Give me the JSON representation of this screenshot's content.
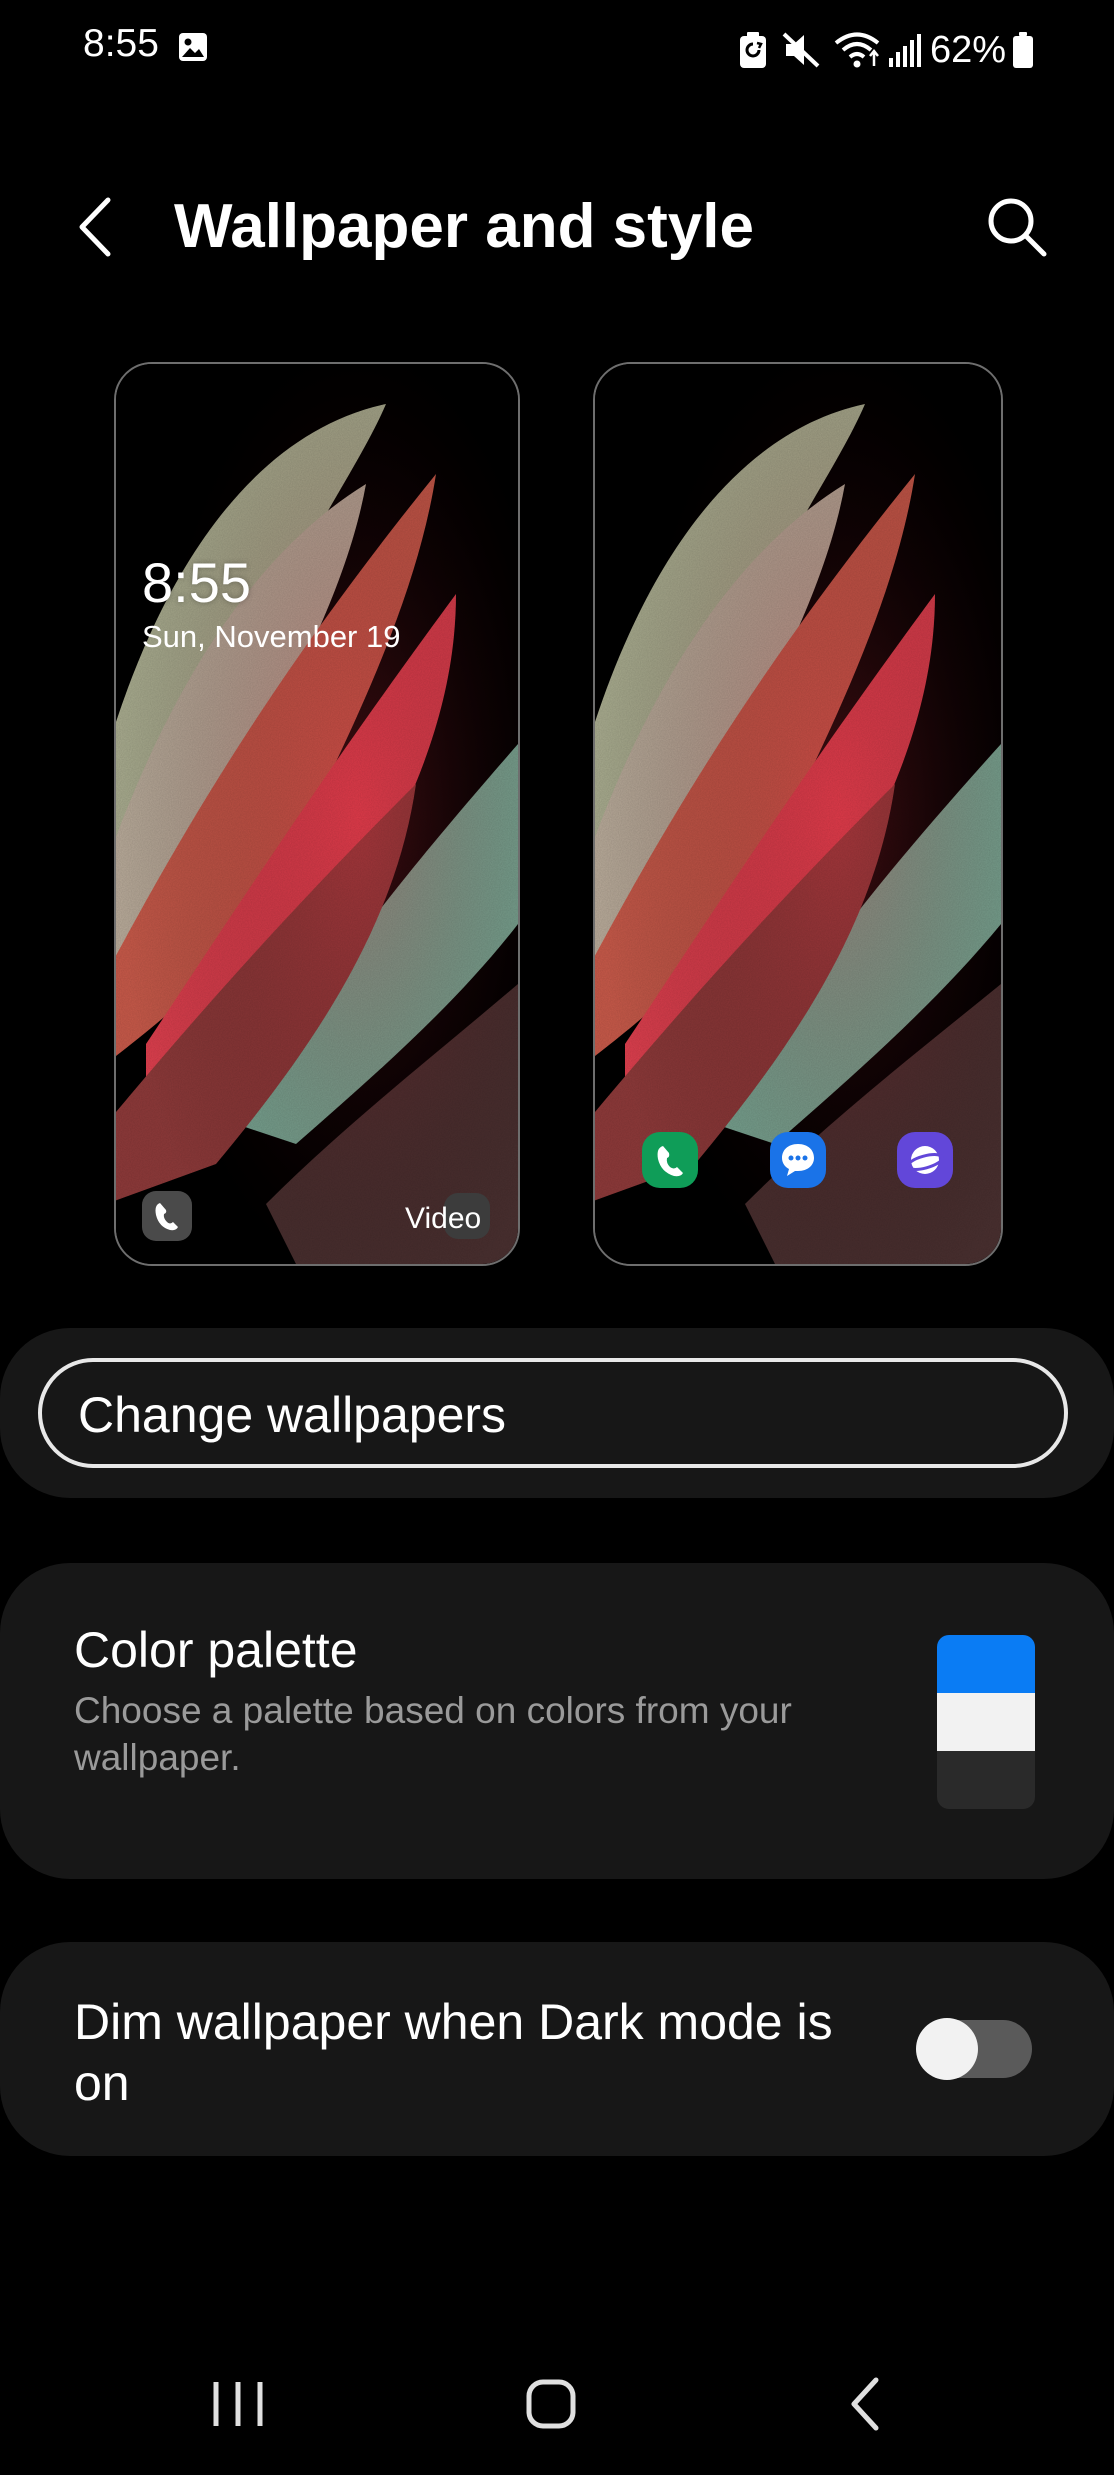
{
  "status_bar": {
    "time": "8:55",
    "battery": "62%",
    "icons": [
      "gallery-icon",
      "battery-saver-icon",
      "mute-icon",
      "wifi-icon",
      "signal-icon",
      "battery-icon"
    ]
  },
  "header": {
    "title": "Wallpaper and style",
    "back_icon": "back-arrow-icon",
    "search_icon": "search-icon"
  },
  "previews": {
    "lock_screen": {
      "time": "8:55",
      "date": "Sun, November 19",
      "video_label": "Video"
    },
    "home_screen": {
      "apps": [
        "phone-icon",
        "messages-icon",
        "internet-icon"
      ]
    }
  },
  "change_wallpapers": {
    "label": "Change wallpapers"
  },
  "color_palette": {
    "title": "Color palette",
    "description": "Choose a palette based on colors from your wallpaper.",
    "swatch_colors": [
      "#0a7cf4",
      "#f2f2f2",
      "#2a2a2a"
    ]
  },
  "dim_wallpaper": {
    "label": "Dim wallpaper when Dark mode is on",
    "enabled": false
  },
  "nav_bar": {
    "buttons": [
      "recents-icon",
      "home-icon",
      "back-icon"
    ]
  },
  "colors": {
    "background": "#000000",
    "card": "#171717",
    "text_primary": "#ffffff",
    "text_secondary": "#9a9a9a",
    "accent_blue": "#0a7cf4"
  }
}
